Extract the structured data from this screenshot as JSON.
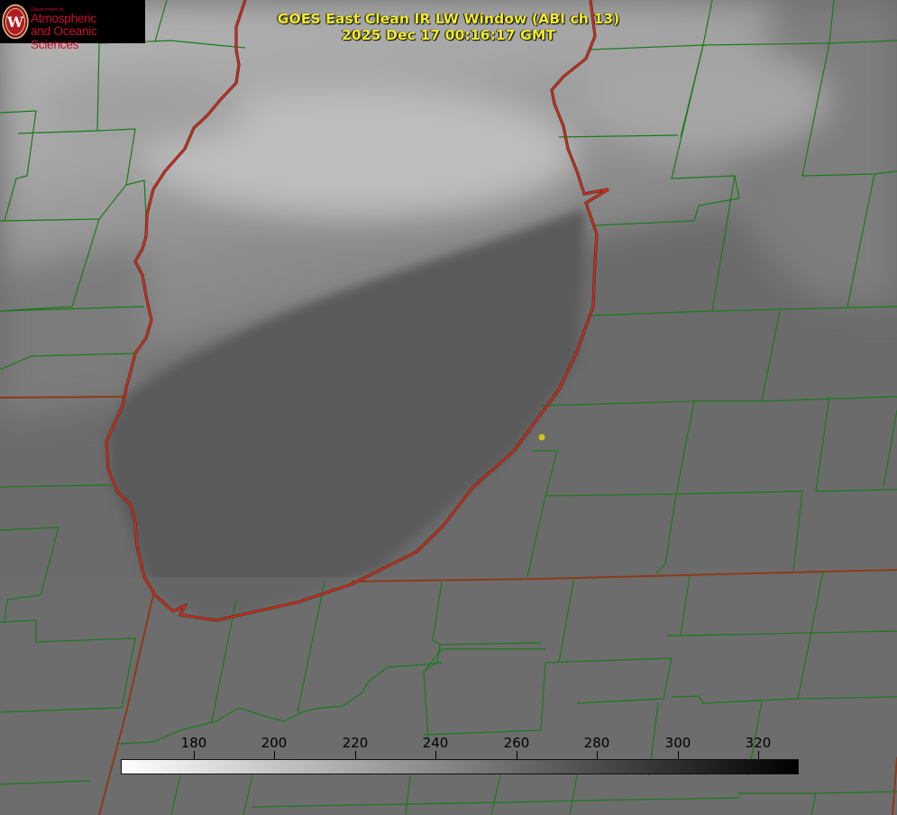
{
  "title": {
    "line1": "GOES East Clean IR LW Window (ABI ch 13)",
    "line2": "2025 Dec 17 00:16:17 GMT"
  },
  "logo": {
    "department": "Department of",
    "line1": "Atmospheric",
    "line2": "and Oceanic Sciences",
    "seal_letter": "W",
    "color": "#c8102e"
  },
  "colorbar": {
    "scale_min": 162,
    "scale_max": 330,
    "gradient_from": "#ffffff",
    "gradient_to": "#000000",
    "ticks": [
      180,
      200,
      220,
      240,
      260,
      280,
      300,
      320
    ]
  },
  "colors": {
    "county_lines": "#1a7a1a",
    "state_lines": "#8b3a1a",
    "coastline": "#e8231b",
    "title": "#f2ee2a",
    "marker": "#d4c21a"
  }
}
